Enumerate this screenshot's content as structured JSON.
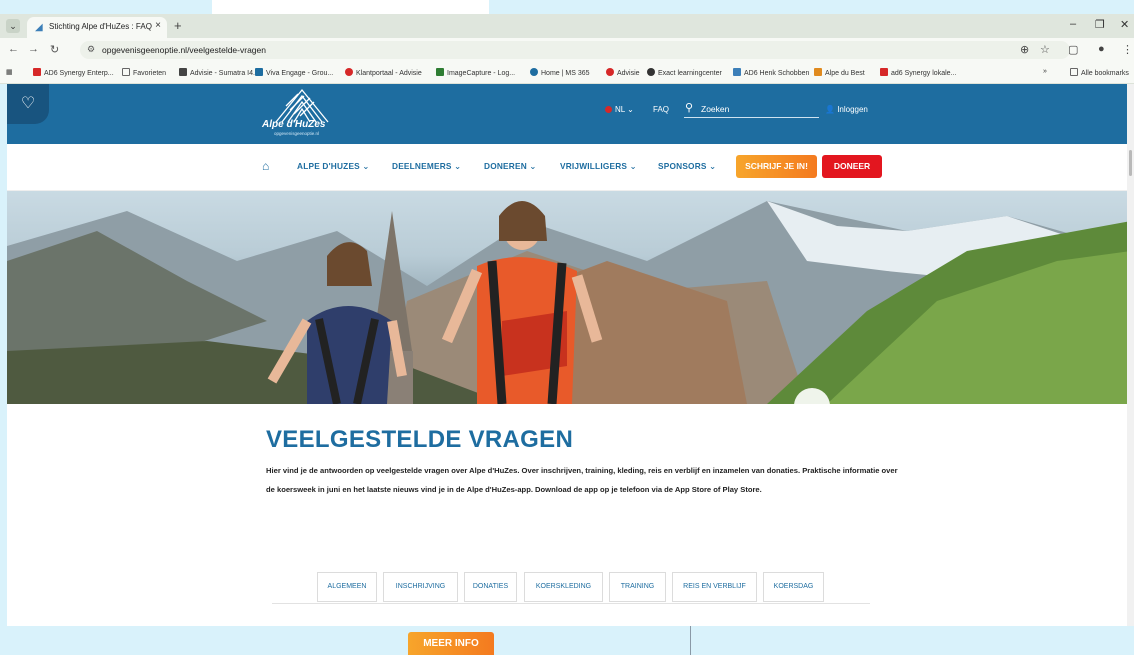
{
  "browser": {
    "tab_title": "Stichting Alpe d'HuZes : FAQ",
    "url": "opgevenisgeenoptie.nl/veelgestelde-vragen",
    "bookmarks": [
      {
        "label": "AD6 Synergy Enterp...",
        "color": "#d62828"
      },
      {
        "label": "Favorieten",
        "color": "#666666"
      },
      {
        "label": "Advisie - Sumatra I4...",
        "color": "#444444"
      },
      {
        "label": "Viva Engage - Grou...",
        "color": "#1e6da0"
      },
      {
        "label": "Klantportaal - Advisie",
        "color": "#d62828"
      },
      {
        "label": "ImageCapture - Log...",
        "color": "#2e7d32"
      },
      {
        "label": "Home | MS 365",
        "color": "#1e6da0"
      },
      {
        "label": "Advisie",
        "color": "#d62828"
      },
      {
        "label": "Exact learningcenter",
        "color": "#333333"
      },
      {
        "label": "AD6 Henk Schobben",
        "color": "#3c7fb8"
      },
      {
        "label": "Alpe du Best",
        "color": "#e08a1e"
      },
      {
        "label": "ad6 Synergy lokale...",
        "color": "#d62828"
      }
    ],
    "all_bookmarks": "Alle bookmarks"
  },
  "header": {
    "logo_text": "Alpe d'HuZes",
    "logo_sub": "opgevenisgeenoptie.nl",
    "lang": "NL",
    "faq": "FAQ",
    "search_placeholder": "Zoeken",
    "login": "Inloggen"
  },
  "nav": {
    "items": [
      "ALPE D'HUZES",
      "DEELNEMERS",
      "DONEREN",
      "VRIJWILLIGERS",
      "SPONSORS"
    ],
    "cta_register": "SCHRIJF JE IN!",
    "cta_donate": "DONEER"
  },
  "page": {
    "title": "VEELGESTELDE VRAGEN",
    "intro": "Hier vind je de antwoorden op veelgestelde vragen over Alpe d'HuZes. Over inschrijven, training, kleding, reis en verblijf en inzamelen van donaties. Praktische informatie over de koersweek in juni en het laatste nieuws vind je in de Alpe d'HuZes-app. Download de app op je telefoon via de App Store of Play Store.",
    "categories": [
      "ALGEMEEN",
      "INSCHRIJVING",
      "DONATIES",
      "KOERSKLEDING",
      "TRAINING",
      "REIS EN VERBLIJF",
      "KOERSDAG"
    ],
    "more_info": "MEER INFO"
  },
  "colors": {
    "brand_blue": "#1e6da0",
    "orange": "#f47a1f",
    "red": "#e3161f"
  }
}
